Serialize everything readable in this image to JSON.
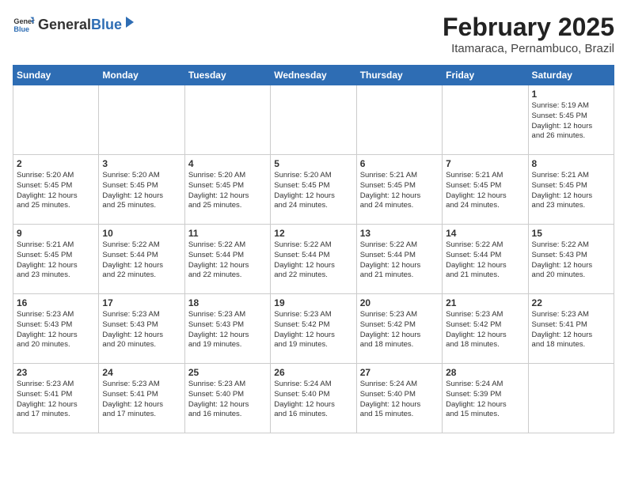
{
  "logo": {
    "general": "General",
    "blue": "Blue"
  },
  "title": "February 2025",
  "subtitle": "Itamaraca, Pernambuco, Brazil",
  "days_of_week": [
    "Sunday",
    "Monday",
    "Tuesday",
    "Wednesday",
    "Thursday",
    "Friday",
    "Saturday"
  ],
  "weeks": [
    [
      {
        "day": "",
        "info": ""
      },
      {
        "day": "",
        "info": ""
      },
      {
        "day": "",
        "info": ""
      },
      {
        "day": "",
        "info": ""
      },
      {
        "day": "",
        "info": ""
      },
      {
        "day": "",
        "info": ""
      },
      {
        "day": "1",
        "info": "Sunrise: 5:19 AM\nSunset: 5:45 PM\nDaylight: 12 hours\nand 26 minutes."
      }
    ],
    [
      {
        "day": "2",
        "info": "Sunrise: 5:20 AM\nSunset: 5:45 PM\nDaylight: 12 hours\nand 25 minutes."
      },
      {
        "day": "3",
        "info": "Sunrise: 5:20 AM\nSunset: 5:45 PM\nDaylight: 12 hours\nand 25 minutes."
      },
      {
        "day": "4",
        "info": "Sunrise: 5:20 AM\nSunset: 5:45 PM\nDaylight: 12 hours\nand 25 minutes."
      },
      {
        "day": "5",
        "info": "Sunrise: 5:20 AM\nSunset: 5:45 PM\nDaylight: 12 hours\nand 24 minutes."
      },
      {
        "day": "6",
        "info": "Sunrise: 5:21 AM\nSunset: 5:45 PM\nDaylight: 12 hours\nand 24 minutes."
      },
      {
        "day": "7",
        "info": "Sunrise: 5:21 AM\nSunset: 5:45 PM\nDaylight: 12 hours\nand 24 minutes."
      },
      {
        "day": "8",
        "info": "Sunrise: 5:21 AM\nSunset: 5:45 PM\nDaylight: 12 hours\nand 23 minutes."
      }
    ],
    [
      {
        "day": "9",
        "info": "Sunrise: 5:21 AM\nSunset: 5:45 PM\nDaylight: 12 hours\nand 23 minutes."
      },
      {
        "day": "10",
        "info": "Sunrise: 5:22 AM\nSunset: 5:44 PM\nDaylight: 12 hours\nand 22 minutes."
      },
      {
        "day": "11",
        "info": "Sunrise: 5:22 AM\nSunset: 5:44 PM\nDaylight: 12 hours\nand 22 minutes."
      },
      {
        "day": "12",
        "info": "Sunrise: 5:22 AM\nSunset: 5:44 PM\nDaylight: 12 hours\nand 22 minutes."
      },
      {
        "day": "13",
        "info": "Sunrise: 5:22 AM\nSunset: 5:44 PM\nDaylight: 12 hours\nand 21 minutes."
      },
      {
        "day": "14",
        "info": "Sunrise: 5:22 AM\nSunset: 5:44 PM\nDaylight: 12 hours\nand 21 minutes."
      },
      {
        "day": "15",
        "info": "Sunrise: 5:22 AM\nSunset: 5:43 PM\nDaylight: 12 hours\nand 20 minutes."
      }
    ],
    [
      {
        "day": "16",
        "info": "Sunrise: 5:23 AM\nSunset: 5:43 PM\nDaylight: 12 hours\nand 20 minutes."
      },
      {
        "day": "17",
        "info": "Sunrise: 5:23 AM\nSunset: 5:43 PM\nDaylight: 12 hours\nand 20 minutes."
      },
      {
        "day": "18",
        "info": "Sunrise: 5:23 AM\nSunset: 5:43 PM\nDaylight: 12 hours\nand 19 minutes."
      },
      {
        "day": "19",
        "info": "Sunrise: 5:23 AM\nSunset: 5:42 PM\nDaylight: 12 hours\nand 19 minutes."
      },
      {
        "day": "20",
        "info": "Sunrise: 5:23 AM\nSunset: 5:42 PM\nDaylight: 12 hours\nand 18 minutes."
      },
      {
        "day": "21",
        "info": "Sunrise: 5:23 AM\nSunset: 5:42 PM\nDaylight: 12 hours\nand 18 minutes."
      },
      {
        "day": "22",
        "info": "Sunrise: 5:23 AM\nSunset: 5:41 PM\nDaylight: 12 hours\nand 18 minutes."
      }
    ],
    [
      {
        "day": "23",
        "info": "Sunrise: 5:23 AM\nSunset: 5:41 PM\nDaylight: 12 hours\nand 17 minutes."
      },
      {
        "day": "24",
        "info": "Sunrise: 5:23 AM\nSunset: 5:41 PM\nDaylight: 12 hours\nand 17 minutes."
      },
      {
        "day": "25",
        "info": "Sunrise: 5:23 AM\nSunset: 5:40 PM\nDaylight: 12 hours\nand 16 minutes."
      },
      {
        "day": "26",
        "info": "Sunrise: 5:24 AM\nSunset: 5:40 PM\nDaylight: 12 hours\nand 16 minutes."
      },
      {
        "day": "27",
        "info": "Sunrise: 5:24 AM\nSunset: 5:40 PM\nDaylight: 12 hours\nand 15 minutes."
      },
      {
        "day": "28",
        "info": "Sunrise: 5:24 AM\nSunset: 5:39 PM\nDaylight: 12 hours\nand 15 minutes."
      },
      {
        "day": "",
        "info": ""
      }
    ]
  ]
}
